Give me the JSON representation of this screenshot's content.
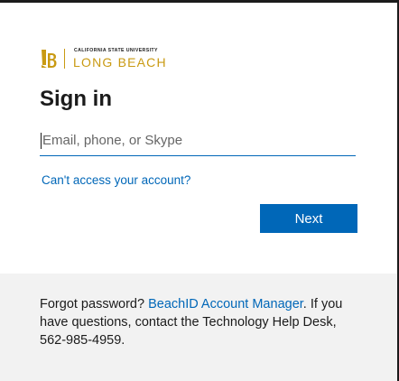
{
  "logo": {
    "monogram": "LB",
    "small_text": "CALIFORNIA STATE UNIVERSITY",
    "big_text": "LONG BEACH",
    "brand_color": "#c99a12"
  },
  "title": "Sign in",
  "email_input": {
    "value": "",
    "placeholder": "Email, phone, or Skype"
  },
  "cant_access_link": "Can't access your account?",
  "next_button": "Next",
  "footer": {
    "prefix": "Forgot password? ",
    "link": "BeachID Account Manager",
    "suffix": ". If you have questions, contact the Technology Help Desk, 562-985-4959."
  },
  "colors": {
    "accent": "#0067b8",
    "footer_bg": "#f2f2f2"
  }
}
